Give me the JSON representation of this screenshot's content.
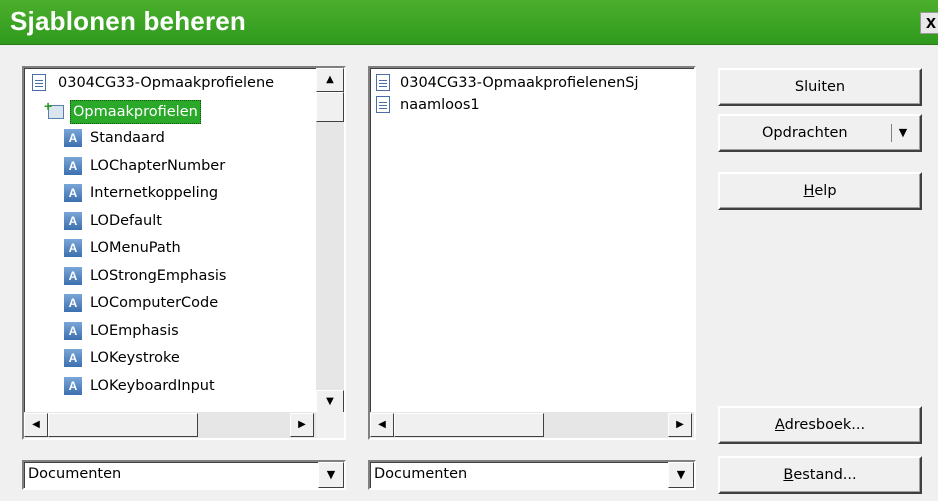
{
  "dialog": {
    "title": "Sjablonen beheren",
    "close_glyph": "x"
  },
  "left_tree": {
    "items": [
      {
        "label": "0304CG33-Opmaakprofielene",
        "icon": "document-icon",
        "level": 0
      },
      {
        "label": "Opmaakprofielen",
        "icon": "folder-icon",
        "level": 1,
        "selected": true
      },
      {
        "label": "Standaard",
        "icon": "style-icon",
        "level": 2
      },
      {
        "label": "LOChapterNumber",
        "icon": "style-icon",
        "level": 2
      },
      {
        "label": "Internetkoppeling",
        "icon": "style-icon",
        "level": 2
      },
      {
        "label": "LODefault",
        "icon": "style-icon",
        "level": 2
      },
      {
        "label": "LOMenuPath",
        "icon": "style-icon",
        "level": 2
      },
      {
        "label": "LOStrongEmphasis",
        "icon": "style-icon",
        "level": 2
      },
      {
        "label": "LOComputerCode",
        "icon": "style-icon",
        "level": 2
      },
      {
        "label": "LOEmphasis",
        "icon": "style-icon",
        "level": 2
      },
      {
        "label": "LOKeystroke",
        "icon": "style-icon",
        "level": 2
      },
      {
        "label": "LOKeyboardInput",
        "icon": "style-icon",
        "level": 2
      }
    ],
    "style_icon_glyph": "A"
  },
  "right_list": {
    "items": [
      {
        "label": "0304CG33-OpmaakprofielenenSj",
        "icon": "document-icon"
      },
      {
        "label": "naamloos1",
        "icon": "document-icon"
      }
    ]
  },
  "buttons": {
    "close": "Sluiten",
    "commands": "Opdrachten",
    "help_mnemonic": "H",
    "help_rest": "elp",
    "addressbook_mnemonic": "A",
    "addressbook_rest": "dresboek...",
    "file_mnemonic": "B",
    "file_rest": "estand..."
  },
  "combos": {
    "left_value": "Documenten",
    "right_value": "Documenten"
  },
  "glyphs": {
    "up": "▲",
    "down": "▼",
    "left": "◀",
    "right": "▶"
  },
  "colors": {
    "titlebar": "#3aa324",
    "selection": "#2aa82a"
  }
}
